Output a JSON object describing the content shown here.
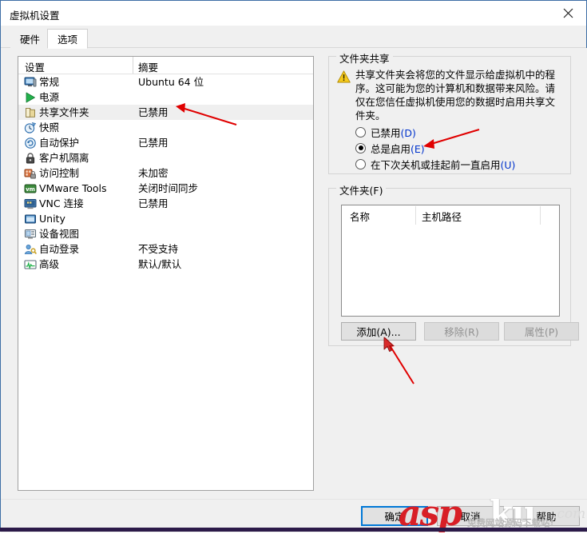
{
  "window": {
    "title": "虚拟机设置",
    "close_label": "×"
  },
  "tabs": [
    {
      "label": "硬件",
      "active": false
    },
    {
      "label": "选项",
      "active": true
    }
  ],
  "settings_list": {
    "headers": {
      "settings": "设置",
      "summary": "摘要"
    },
    "rows": [
      {
        "icon": "monitor-icon",
        "label": "常规",
        "summary": "Ubuntu 64 位",
        "selected": false
      },
      {
        "icon": "power-play-icon",
        "label": "电源",
        "summary": "",
        "selected": false
      },
      {
        "icon": "folder-icon",
        "label": "共享文件夹",
        "summary": "已禁用",
        "selected": true
      },
      {
        "icon": "snapshot-clock-icon",
        "label": "快照",
        "summary": "",
        "selected": false
      },
      {
        "icon": "autoprotect-icon",
        "label": "自动保护",
        "summary": "已禁用",
        "selected": false
      },
      {
        "icon": "lock-icon",
        "label": "客户机隔离",
        "summary": "",
        "selected": false
      },
      {
        "icon": "access-control-icon",
        "label": "访问控制",
        "summary": "未加密",
        "selected": false
      },
      {
        "icon": "vmware-tools-icon",
        "label": "VMware Tools",
        "summary": "关闭时间同步",
        "selected": false
      },
      {
        "icon": "vnc-screen-icon",
        "label": "VNC 连接",
        "summary": "已禁用",
        "selected": false
      },
      {
        "icon": "unity-window-icon",
        "label": "Unity",
        "summary": "",
        "selected": false
      },
      {
        "icon": "device-view-icon",
        "label": "设备视图",
        "summary": "",
        "selected": false
      },
      {
        "icon": "auto-login-icon",
        "label": "自动登录",
        "summary": "不受支持",
        "selected": false
      },
      {
        "icon": "advanced-icon",
        "label": "高级",
        "summary": "默认/默认",
        "selected": false
      }
    ]
  },
  "folder_sharing": {
    "group_title": "文件夹共享",
    "warning_icon": "warning-triangle-icon",
    "warning_text": "共享文件夹会将您的文件显示给虚拟机中的程序。这可能为您的计算机和数据带来风险。请仅在您信任虚拟机使用您的数据时启用共享文件夹。",
    "options": [
      {
        "label": "已禁用(D)",
        "text": "已禁用",
        "accel": "(D)",
        "checked": false
      },
      {
        "label": "总是启用(E)",
        "text": "总是启用",
        "accel": "(E)",
        "checked": true
      },
      {
        "label": "在下次关机或挂起前一直启用(U)",
        "text": "在下次关机或挂起前一直启用",
        "accel": "(U)",
        "checked": false
      }
    ]
  },
  "folders": {
    "group_title": "文件夹(F)",
    "columns": [
      "名称",
      "主机路径",
      ""
    ],
    "rows": [],
    "buttons": [
      {
        "label": "添加(A)...",
        "disabled": false
      },
      {
        "label": "移除(R)",
        "disabled": true
      },
      {
        "label": "属性(P)",
        "disabled": true
      }
    ]
  },
  "dialog_buttons": [
    {
      "label": "确定",
      "default": true
    },
    {
      "label": "取消",
      "default": false
    },
    {
      "label": "帮助",
      "default": false
    }
  ],
  "watermark": {
    "asp": "asp",
    "ku": "ku",
    "com": ".com",
    "subtitle": "免费网站源码下载站!"
  },
  "colors": {
    "accent": "#0078d7",
    "annotation": "#e00000",
    "warning": "#f5c518",
    "selected_row": "#efefef"
  }
}
